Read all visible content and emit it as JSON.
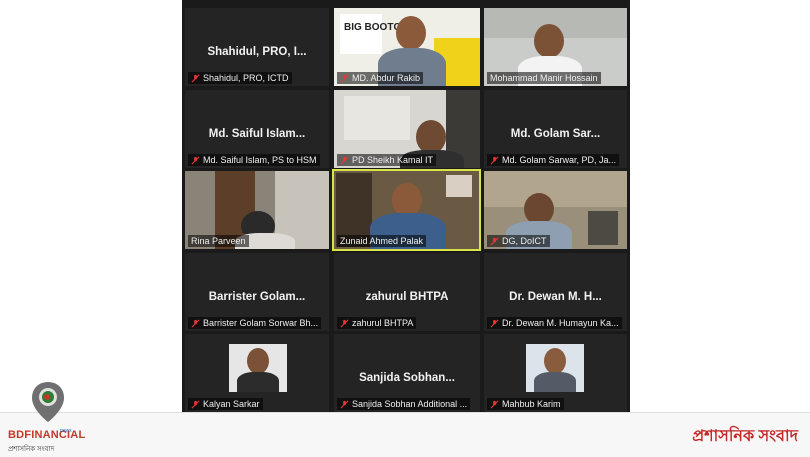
{
  "tiles": [
    {
      "display": "Shahidul,  PRO,  I...",
      "label": "Shahidul, PRO, ICTD"
    },
    {
      "label": "MD. Abdur Rakib",
      "poster_text": "BIG BOOTCAMP"
    },
    {
      "label": "Mohammad Manir Hossain"
    },
    {
      "display": "Md.  Saiful  Islam...",
      "label": "Md. Saiful Islam, PS to HSM"
    },
    {
      "label": "PD Sheikh Kamal IT"
    },
    {
      "display": "Md.  Golam  Sar...",
      "label": "Md. Golam Sarwar, PD, Ja..."
    },
    {
      "label": "Rina Parveen"
    },
    {
      "label": "Zunaid Ahmed Palak"
    },
    {
      "label": "DG, DoICT"
    },
    {
      "display": "Barrister  Golam...",
      "label": "Barrister Golam Sorwar Bh..."
    },
    {
      "display": "zahurul BHTPA",
      "label": "zahurul BHTPA"
    },
    {
      "display": "Dr.  Dewan  M.  H...",
      "label": "Dr. Dewan M. Humayun Ka..."
    },
    {
      "label": "Kalyan Sarkar"
    },
    {
      "display": "Sanjida  Sobhan...",
      "label": "Sanjida Sobhan Additional ..."
    },
    {
      "label": "Mahbub Karim"
    }
  ],
  "brand": {
    "name": "BDFINANCIAL",
    "tag": "news",
    "subtitle": "প্রশাসনিক সংবাদ"
  },
  "banner_right": "প্রশাসনিক সংবাদ",
  "colors": {
    "active_border": "#d8e44a",
    "brand_red": "#c62828",
    "mic_muted": "#e53935"
  }
}
